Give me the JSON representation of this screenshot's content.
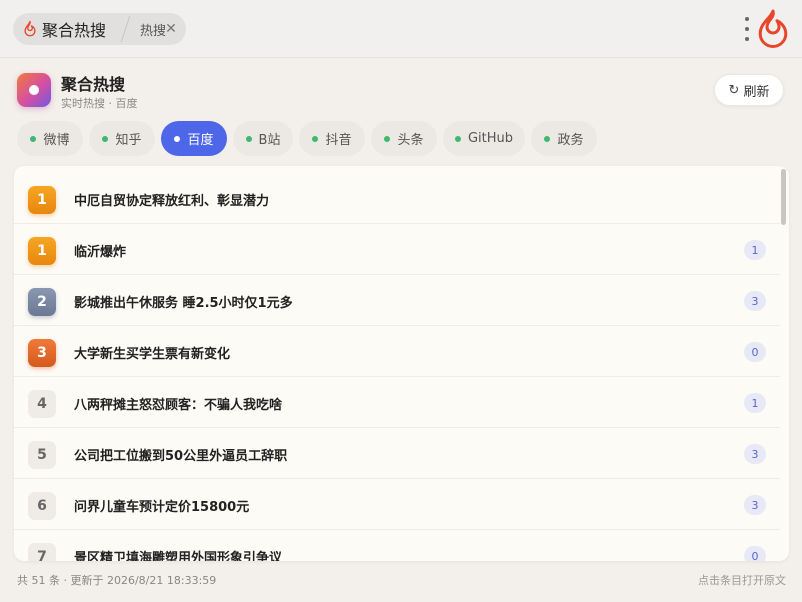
{
  "titlebar": {
    "app_name": "聚合热搜",
    "tab_label": "热搜",
    "close_glyph": "✕",
    "flame_color": "#e8452c"
  },
  "header": {
    "title": "聚合热搜",
    "subtitle": "实时热搜 · 百度",
    "refresh_label": "刷新",
    "refresh_glyph": "↻"
  },
  "tabs": [
    {
      "label": "微博",
      "active": false
    },
    {
      "label": "知乎",
      "active": false
    },
    {
      "label": "百度",
      "active": true
    },
    {
      "label": "B站",
      "active": false
    },
    {
      "label": "抖音",
      "active": false
    },
    {
      "label": "头条",
      "active": false
    },
    {
      "label": "GitHub",
      "active": false
    },
    {
      "label": "政务",
      "active": false
    }
  ],
  "list": [
    {
      "rank": "1",
      "rank_style": "gold",
      "title": "中厄自贸协定释放红利、彰显潜力",
      "badge": ""
    },
    {
      "rank": "1",
      "rank_style": "gold",
      "title": "临沂爆炸",
      "badge": "1"
    },
    {
      "rank": "2",
      "rank_style": "silver",
      "title": "影城推出午休服务 睡2.5小时仅1元多",
      "badge": "3"
    },
    {
      "rank": "3",
      "rank_style": "bronze",
      "title": "大学新生买学生票有新变化",
      "badge": "0"
    },
    {
      "rank": "4",
      "rank_style": "plain",
      "title": "八两秤摊主怒怼顾客：不骗人我吃啥",
      "badge": "1"
    },
    {
      "rank": "5",
      "rank_style": "plain",
      "title": "公司把工位搬到50公里外逼员工辞职",
      "badge": "3"
    },
    {
      "rank": "6",
      "rank_style": "plain",
      "title": "问界儿童车预计定价15800元",
      "badge": "3"
    },
    {
      "rank": "7",
      "rank_style": "plain",
      "title": "景区精卫填海雕塑用外国形象引争议",
      "badge": "0"
    }
  ],
  "footer": {
    "status": "共 51 条 · 更新于 2026/8/21 18:33:59",
    "hint": "点击条目打开原文"
  },
  "colors": {
    "accent": "#4e66e8",
    "tab_dot": "#3cb86f",
    "badge_text": "#5b66c9"
  }
}
